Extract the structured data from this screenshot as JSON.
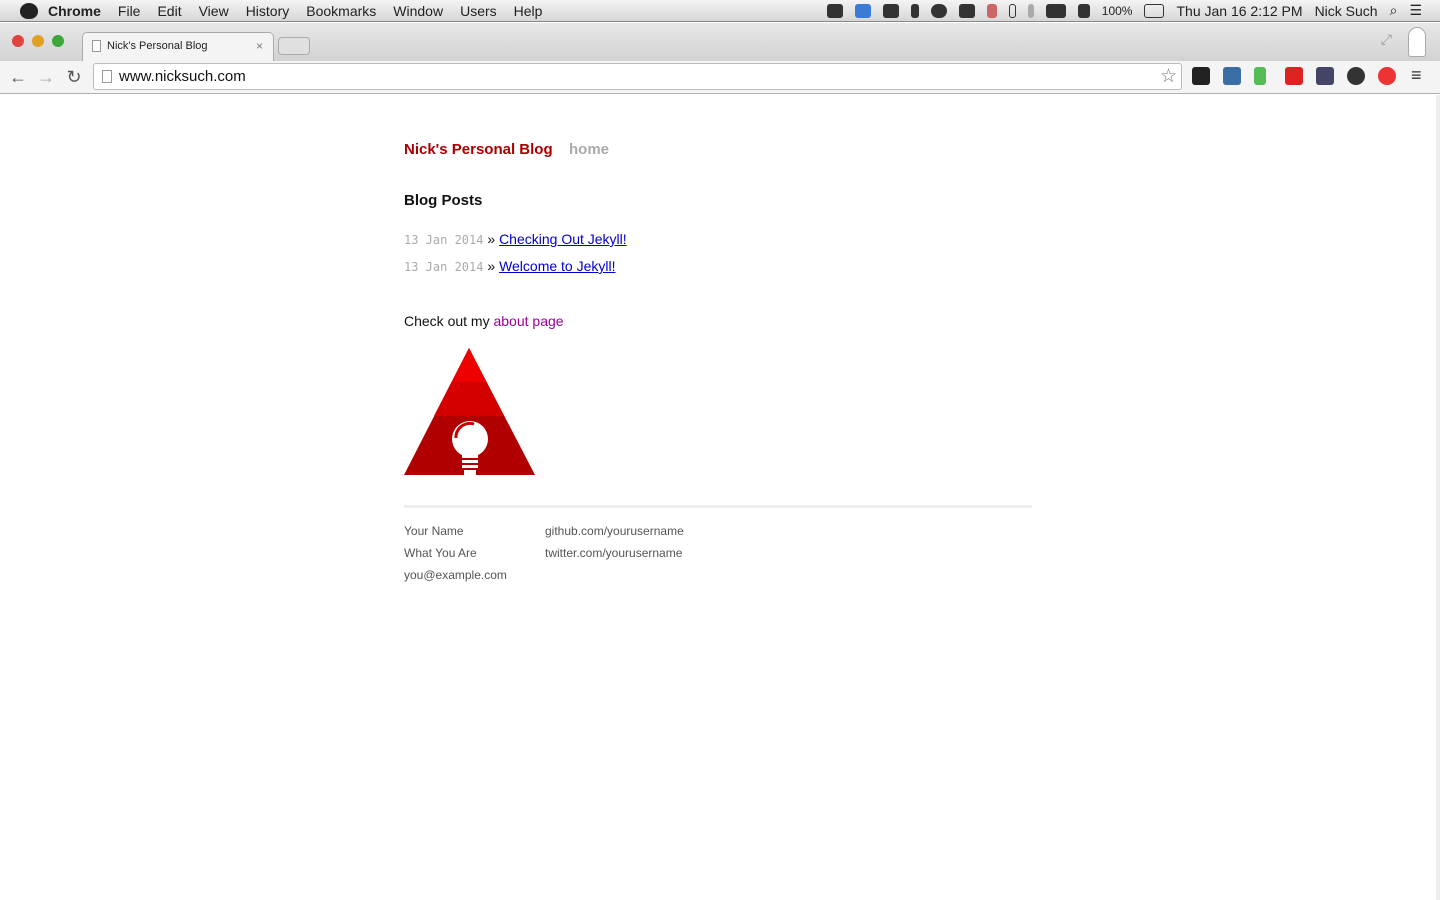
{
  "menubar": {
    "app": "Chrome",
    "items": [
      "File",
      "Edit",
      "View",
      "History",
      "Bookmarks",
      "Window",
      "Users",
      "Help"
    ],
    "battery": "100%",
    "clock": "Thu Jan 16  2:12 PM",
    "user": "Nick Such"
  },
  "tab": {
    "title": "Nick's Personal Blog",
    "close": "×"
  },
  "toolbar": {
    "url": "www.nicksuch.com",
    "star": "☆",
    "back": "←",
    "forward": "→",
    "reload": "↻",
    "menu": "≡"
  },
  "extensions": [
    "buffer-icon",
    "hootsuite-icon",
    "evernote-icon",
    "gmail-icon",
    "camera-icon",
    "gear-icon",
    "adblock-icon"
  ],
  "site": {
    "title": "Nick's Personal Blog",
    "nav_home": "home",
    "heading": "Blog Posts",
    "posts": [
      {
        "date": "13 Jan 2014",
        "sep": "»",
        "title": "Checking Out Jekyll!"
      },
      {
        "date": "13 Jan 2014",
        "sep": "»",
        "title": "Welcome to Jekyll!"
      }
    ],
    "about_prefix": "Check out my ",
    "about_link": "about page"
  },
  "footer": {
    "name": "Your Name",
    "role": "What You Are",
    "email": "you@example.com",
    "github": "github.com/yourusername",
    "twitter": "twitter.com/yourusername"
  },
  "colors": {
    "title": "#aa0000",
    "link": "#0000cc",
    "visited": "#990099"
  }
}
